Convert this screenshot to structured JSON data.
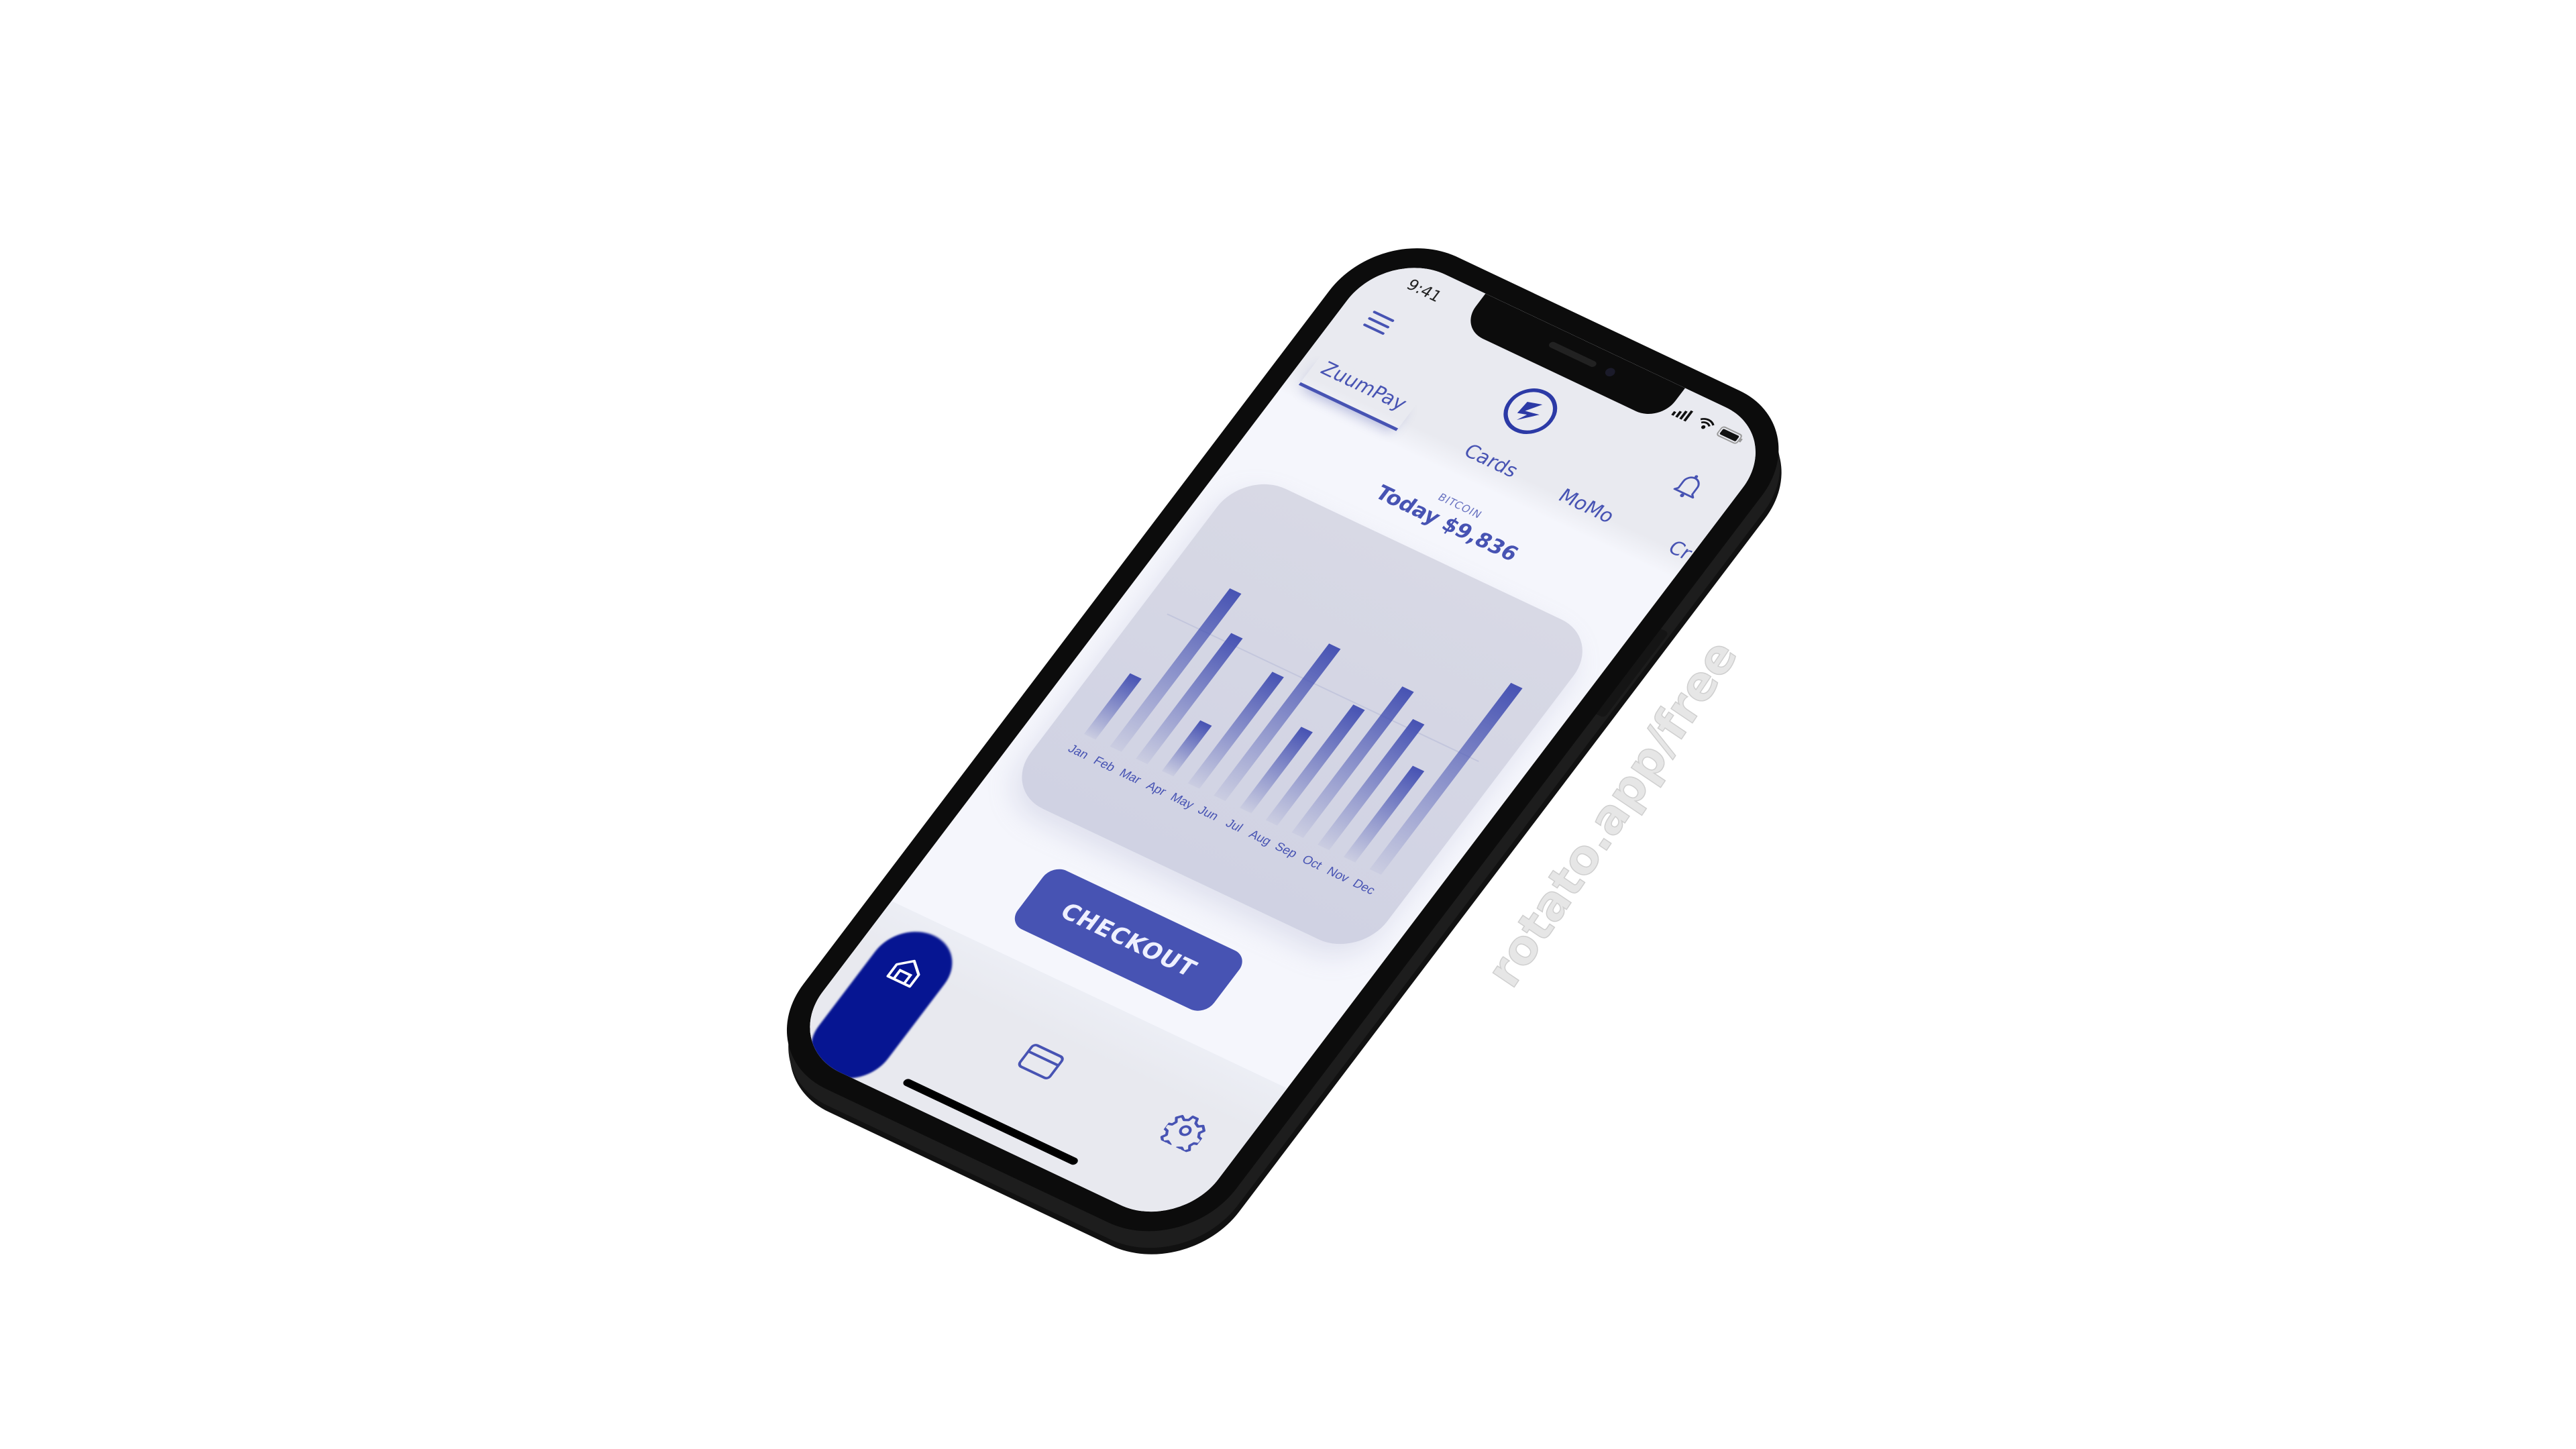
{
  "status_bar": {
    "time": "9:41"
  },
  "header": {
    "menu_icon": "hamburger-icon",
    "logo_icon": "zuumpay-logo",
    "notification_icon": "bell-icon"
  },
  "tabs": [
    {
      "label": "ZuumPay",
      "active": true
    },
    {
      "label": "Cards",
      "active": false
    },
    {
      "label": "MoMo",
      "active": false
    },
    {
      "label": "Cr",
      "active": false
    }
  ],
  "price": {
    "label": "BITCOIN",
    "value": "Today $9,836"
  },
  "chart_data": {
    "type": "bar",
    "categories": [
      "Jan",
      "Feb",
      "Mar",
      "Apr",
      "May",
      "Jun",
      "Jul",
      "Aug",
      "Sep",
      "Oct",
      "Nov",
      "Dec"
    ],
    "values": [
      30,
      78,
      62,
      25,
      55,
      75,
      40,
      57,
      72,
      62,
      45,
      92
    ],
    "ylim": [
      0,
      100
    ],
    "title": "",
    "xlabel": "",
    "ylabel": "",
    "grid": false,
    "bar_color": "#4753b3"
  },
  "checkout": {
    "label": "CHECKOUT"
  },
  "bottom_nav": {
    "items": [
      {
        "icon": "home-icon",
        "active": true
      },
      {
        "icon": "credit-card-icon"
      },
      {
        "icon": "gear-icon"
      }
    ]
  },
  "colors": {
    "accent": "#4753b3",
    "active_nav": "#061592",
    "background": "#f5f6fc",
    "card": "#d8d9e5"
  },
  "watermark": "rotato.app/free"
}
